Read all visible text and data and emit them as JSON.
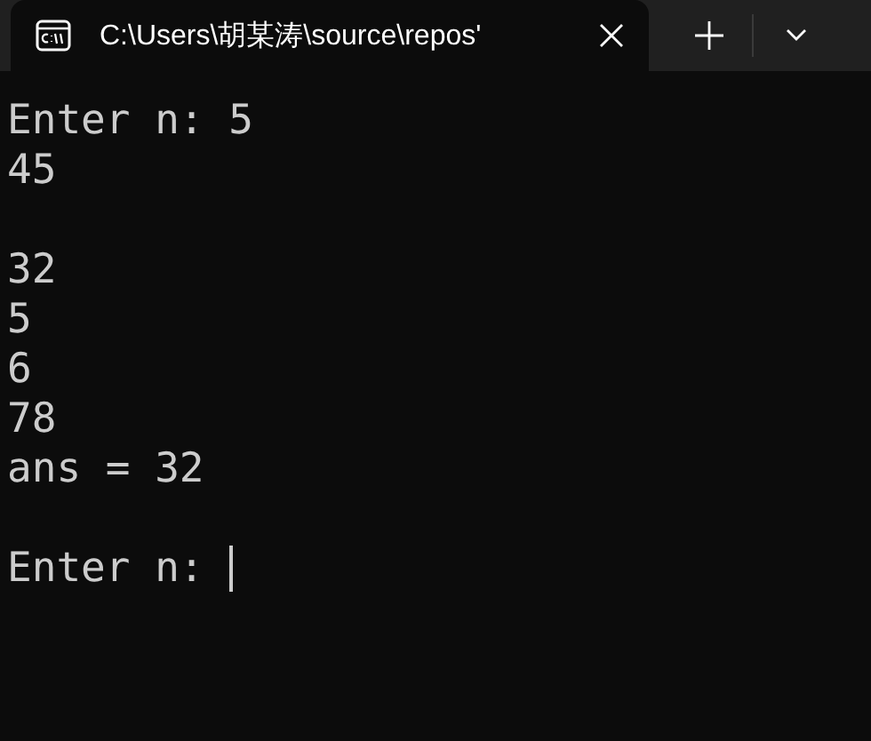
{
  "tab": {
    "title": "C:\\Users\\胡某涛\\source\\repos'",
    "selected": true
  },
  "blocks": [
    [
      "Enter n: 5",
      "45"
    ],
    [
      "32",
      "5",
      "6",
      "78",
      "ans = 32"
    ],
    [
      "Enter n: "
    ]
  ],
  "cursor": true
}
